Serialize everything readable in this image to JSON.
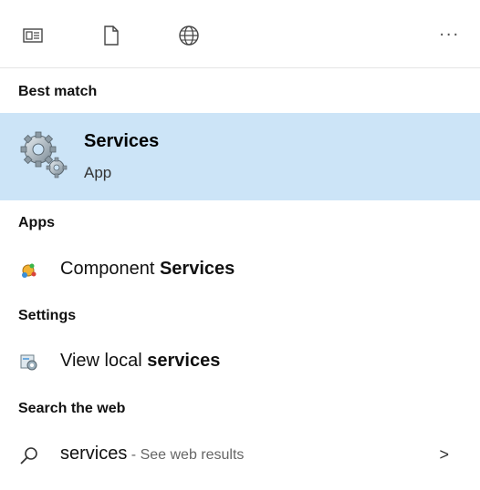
{
  "toolbar": {
    "icons": [
      "all-tab-icon",
      "document-icon",
      "globe-icon"
    ],
    "more_label": "..."
  },
  "best_match": {
    "section_label": "Best match",
    "title": "Services",
    "subtitle": "App",
    "icon": "services-gears-icon"
  },
  "apps": {
    "section_label": "Apps",
    "items": [
      {
        "icon": "component-services-icon",
        "text_normal": "Component ",
        "text_bold": "Services"
      }
    ]
  },
  "settings": {
    "section_label": "Settings",
    "items": [
      {
        "icon": "local-services-icon",
        "text_normal": "View local ",
        "text_bold": "services"
      }
    ]
  },
  "web": {
    "section_label": "Search the web",
    "query": "services",
    "suffix": " - See web results",
    "icon": "search-icon",
    "arrow": ">"
  },
  "colors": {
    "highlight": "#cce4f7",
    "divider": "#e4e4e4"
  }
}
